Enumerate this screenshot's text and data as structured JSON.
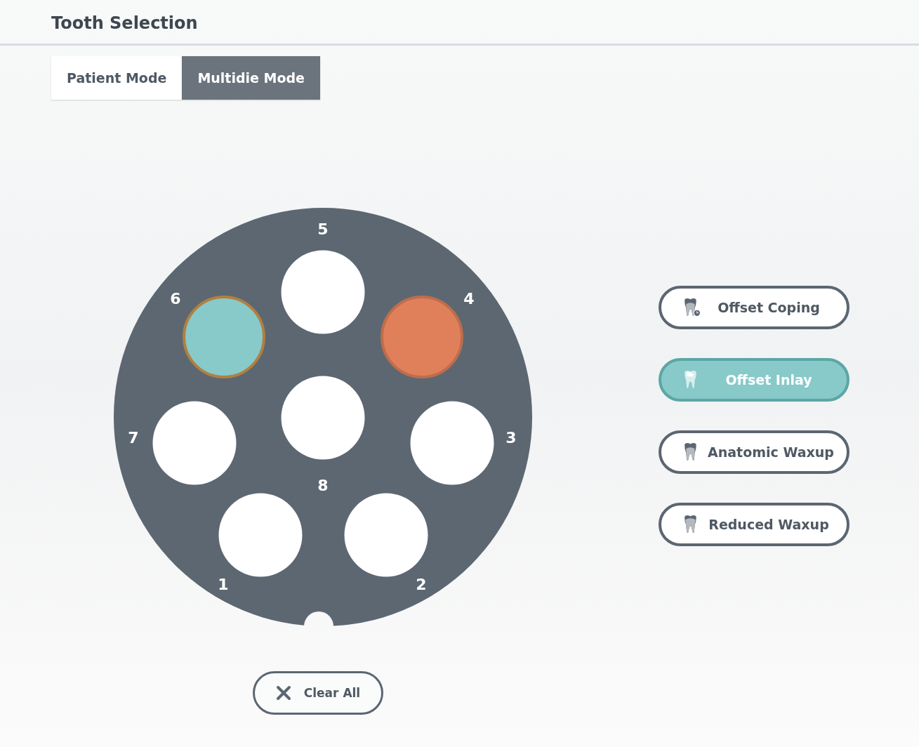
{
  "title": "Tooth Selection",
  "tabs": [
    {
      "label": "Patient Mode",
      "selected": false
    },
    {
      "label": "Multidie Mode",
      "selected": true
    }
  ],
  "dies": [
    {
      "number": "1",
      "selected": false
    },
    {
      "number": "2",
      "selected": false
    },
    {
      "number": "3",
      "selected": false
    },
    {
      "number": "4",
      "selected": false,
      "color": "#e0805a"
    },
    {
      "number": "5",
      "selected": false
    },
    {
      "number": "6",
      "selected": true,
      "color": "#88c9ca"
    },
    {
      "number": "7",
      "selected": false
    },
    {
      "number": "8",
      "selected": false
    }
  ],
  "restorations": [
    {
      "kind": "coping",
      "label": "Offset Coping",
      "selected": false
    },
    {
      "kind": "inlay",
      "label": "Offset Inlay",
      "selected": true
    },
    {
      "kind": "anatomic",
      "label": "Anatomic Waxup",
      "selected": false
    },
    {
      "kind": "reduced",
      "label": "Reduced Waxup",
      "selected": false
    }
  ],
  "clear_button": "Clear All"
}
